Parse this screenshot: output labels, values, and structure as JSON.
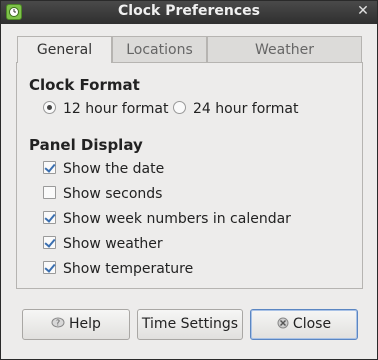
{
  "window": {
    "title": "Clock Preferences",
    "close_glyph": "✕"
  },
  "tabs": [
    {
      "label": "General",
      "active": true
    },
    {
      "label": "Locations",
      "active": false
    },
    {
      "label": "Weather",
      "active": false
    }
  ],
  "clock_format": {
    "title": "Clock Format",
    "options": [
      {
        "label": "12 hour format",
        "selected": true
      },
      {
        "label": "24 hour format",
        "selected": false
      }
    ]
  },
  "panel_display": {
    "title": "Panel Display",
    "options": [
      {
        "label": "Show the date",
        "checked": true
      },
      {
        "label": "Show seconds",
        "checked": false
      },
      {
        "label": "Show week numbers in calendar",
        "checked": true
      },
      {
        "label": "Show weather",
        "checked": true
      },
      {
        "label": "Show temperature",
        "checked": true
      }
    ]
  },
  "buttons": {
    "help": {
      "label": "Help",
      "icon": "help-icon"
    },
    "time_settings": {
      "label": "Time Settings"
    },
    "close": {
      "label": "Close",
      "icon": "close-icon"
    }
  }
}
